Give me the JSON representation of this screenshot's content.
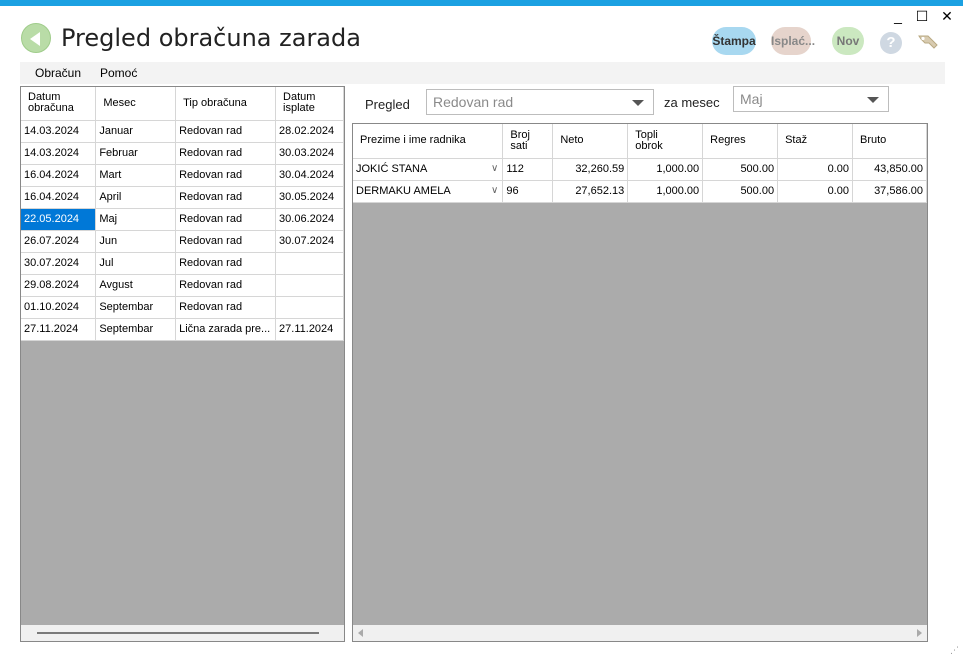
{
  "window": {
    "title": "Pregled obračuna zarada",
    "minimize": "_",
    "maximize": "☐",
    "close": "✕"
  },
  "toolbar": {
    "print_label": "Štampa",
    "payout_label": "Isplać...",
    "new_label": "Nov",
    "help_label": "?"
  },
  "menu": {
    "items": [
      "Obračun",
      "Pomoć"
    ]
  },
  "left_grid": {
    "columns": [
      "Datum\nobračuna",
      "Mesec",
      "Tip obračuna",
      "Datum\nisplate"
    ],
    "rows": [
      [
        "14.03.2024",
        "Januar",
        "Redovan rad",
        "28.02.2024"
      ],
      [
        "14.03.2024",
        "Februar",
        "Redovan rad",
        "30.03.2024"
      ],
      [
        "16.04.2024",
        "Mart",
        "Redovan rad",
        "30.04.2024"
      ],
      [
        "16.04.2024",
        "April",
        "Redovan rad",
        "30.05.2024"
      ],
      [
        "22.05.2024",
        "Maj",
        "Redovan rad",
        "30.06.2024"
      ],
      [
        "26.07.2024",
        "Jun",
        "Redovan rad",
        "30.07.2024"
      ],
      [
        "30.07.2024",
        "Jul",
        "Redovan rad",
        ""
      ],
      [
        "29.08.2024",
        "Avgust",
        "Redovan rad",
        ""
      ],
      [
        "01.10.2024",
        "Septembar",
        "Redovan rad",
        ""
      ],
      [
        "27.11.2024",
        "Septembar",
        "Lična zarada pre...",
        "27.11.2024"
      ]
    ],
    "selected_row": 4
  },
  "filter": {
    "pregled_label": "Pregled",
    "pregled_value": "Redovan rad",
    "mesec_label": "za mesec",
    "mesec_value": "Maj"
  },
  "right_grid": {
    "columns": [
      "Prezime i ime radnika",
      "Broj\nsati",
      "Neto",
      "Topli\nobrok",
      "Regres",
      "Staž",
      "Bruto"
    ],
    "rows": [
      [
        "JOKIĆ STANA",
        "112",
        "32,260.59",
        "1,000.00",
        "500.00",
        "0.00",
        "43,850.00"
      ],
      [
        "DERMAKU AMELA",
        "96",
        "27,652.13",
        "1,000.00",
        "500.00",
        "0.00",
        "37,586.00"
      ]
    ]
  },
  "colors": {
    "accent": "#1ba1e2",
    "selection": "#0078d7",
    "grid_empty": "#ababab"
  }
}
